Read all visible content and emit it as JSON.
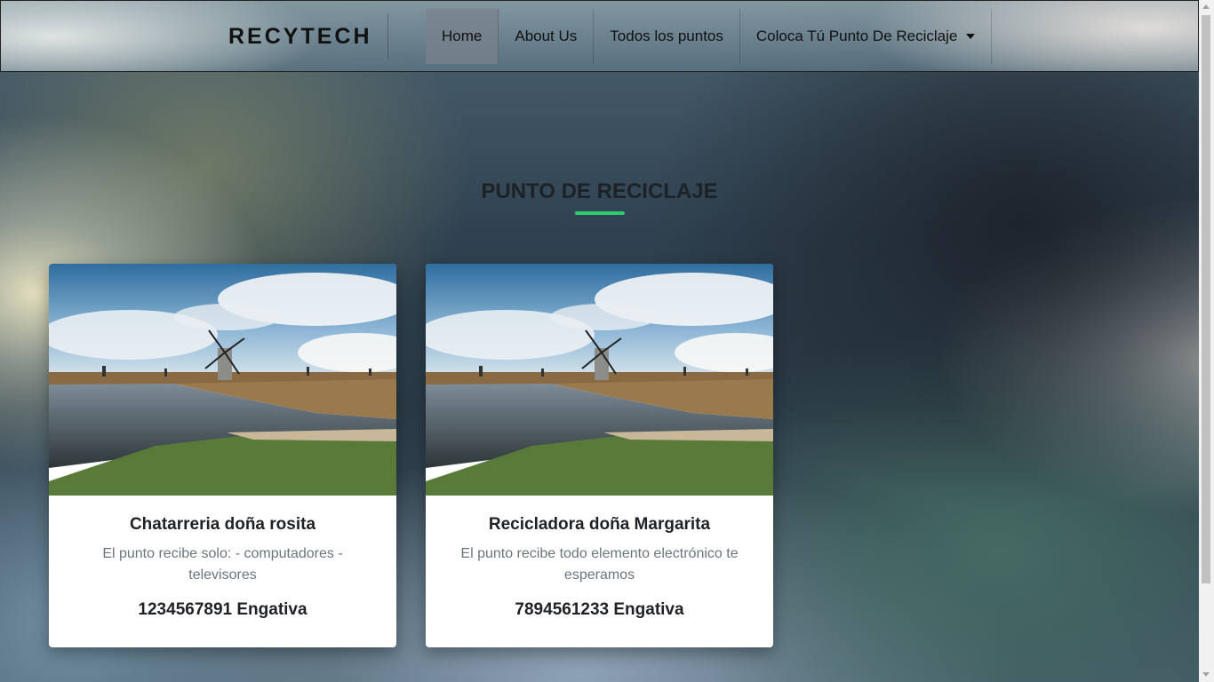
{
  "navbar": {
    "brand": "RECYTECH",
    "items": [
      {
        "label": "Home",
        "active": true
      },
      {
        "label": "About Us",
        "active": false
      },
      {
        "label": "Todos los puntos",
        "active": false
      },
      {
        "label": "Coloca Tú Punto De Reciclaje",
        "active": false,
        "dropdown": true
      }
    ]
  },
  "section": {
    "title": "PUNTO DE RECICLAJE",
    "accent_color": "#2ecc71"
  },
  "cards": [
    {
      "image_icon": "windmill-landscape-image",
      "title": "Chatarreria doña rosita",
      "description": "El punto recibe solo: - computadores - televisores",
      "contact": "1234567891 Engativa"
    },
    {
      "image_icon": "windmill-landscape-image",
      "title": "Recicladora doña Margarita",
      "description": "El punto recibe todo elemento electrónico te esperamos",
      "contact": "7894561233 Engativa"
    }
  ]
}
